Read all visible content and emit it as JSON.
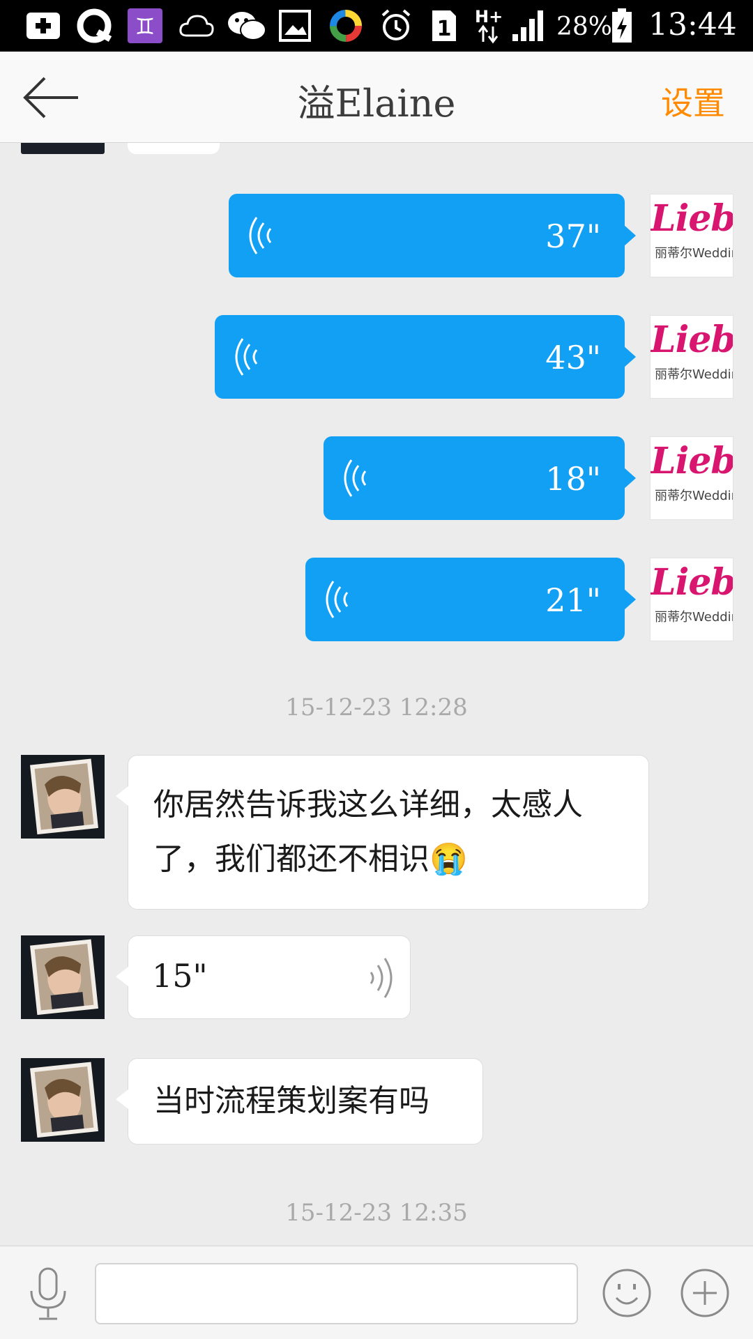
{
  "status_bar": {
    "battery": "28%",
    "time": "13:44",
    "network": "H+",
    "sim": "1"
  },
  "header": {
    "title": "溢Elaine",
    "settings_label": "设置"
  },
  "colors": {
    "accent": "#ff8a00",
    "voice_bubble": "#12a0f5",
    "logo_pink": "#d81670"
  },
  "outgoing_voice": [
    {
      "duration": "37\""
    },
    {
      "duration": "43\""
    },
    {
      "duration": "18\""
    },
    {
      "duration": "21\""
    }
  ],
  "logo_avatar": {
    "brand": "Liebe",
    "sub": "丽蒂尔Wedding 婚礼馆"
  },
  "timestamps": [
    "15-12-23 12:28",
    "15-12-23 12:35"
  ],
  "incoming": {
    "message_1": "你居然告诉我这么详细，太感人了，我们都还不相识😭",
    "voice_duration": "15\"",
    "message_2": "当时流程策划案有吗"
  },
  "input": {
    "placeholder": ""
  }
}
